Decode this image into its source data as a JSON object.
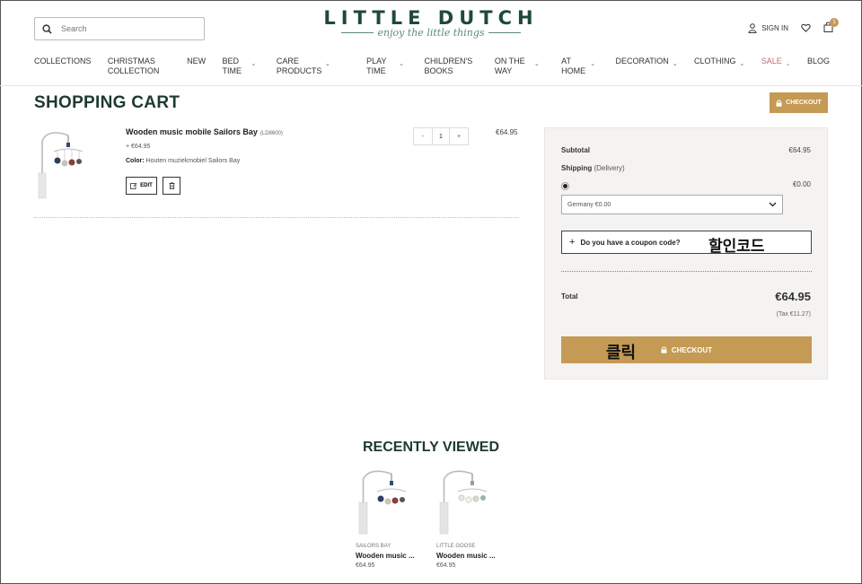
{
  "header": {
    "search_placeholder": "Search",
    "logo_main": "LITTLE DUTCH",
    "logo_tagline": "enjoy the little things",
    "sign_in": "SIGN IN",
    "cart_count": "1"
  },
  "nav": {
    "items": [
      {
        "label": "COLLECTIONS"
      },
      {
        "label": "CHRISTMAS COLLECTION"
      },
      {
        "label": "NEW"
      },
      {
        "label": "BED TIME"
      },
      {
        "label": "CARE PRODUCTS"
      },
      {
        "label": "PLAY TIME"
      },
      {
        "label": "CHILDREN'S BOOKS"
      },
      {
        "label": "ON THE WAY"
      },
      {
        "label": "AT HOME"
      },
      {
        "label": "DECORATION"
      },
      {
        "label": "CLOTHING"
      },
      {
        "label": "SALE"
      },
      {
        "label": "BLOG"
      }
    ]
  },
  "cart": {
    "title": "SHOPPING CART",
    "checkout_top": "CHECKOUT",
    "item": {
      "name": "Wooden music mobile Sailors Bay",
      "sku": "(LD8600)",
      "sub_price": "+ €64.95",
      "color_label": "Color:",
      "color_value": "Houten muziekmobiel Sailors Bay",
      "edit_label": "EDIT",
      "qty_minus": "-",
      "qty_value": "1",
      "qty_plus": "+",
      "price": "€64.95"
    }
  },
  "summary": {
    "subtotal_label": "Subtotal",
    "subtotal_value": "€64.95",
    "shipping_label": "Shipping",
    "shipping_note": "(Delivery)",
    "shipping_value": "€0.00",
    "shipping_select": "Germany €0.00",
    "coupon_label": "Do you have a coupon code?",
    "coupon_annotation": "할인코드",
    "total_label": "Total",
    "total_value": "€64.95",
    "tax": "(Tax €11.27)",
    "checkout_label": "CHECKOUT",
    "click_annotation": "클릭"
  },
  "recently_viewed": {
    "title": "RECENTLY VIEWED",
    "items": [
      {
        "brand": "SAILORS BAY",
        "name": "Wooden music ...",
        "price": "€64.95"
      },
      {
        "brand": "LITTLE GOOSE",
        "name": "Wooden music ...",
        "price": "€64.95"
      }
    ]
  },
  "colors": {
    "accent": "#c59a55",
    "brand_green": "#1e4a3b",
    "sale": "#c76b6b"
  }
}
